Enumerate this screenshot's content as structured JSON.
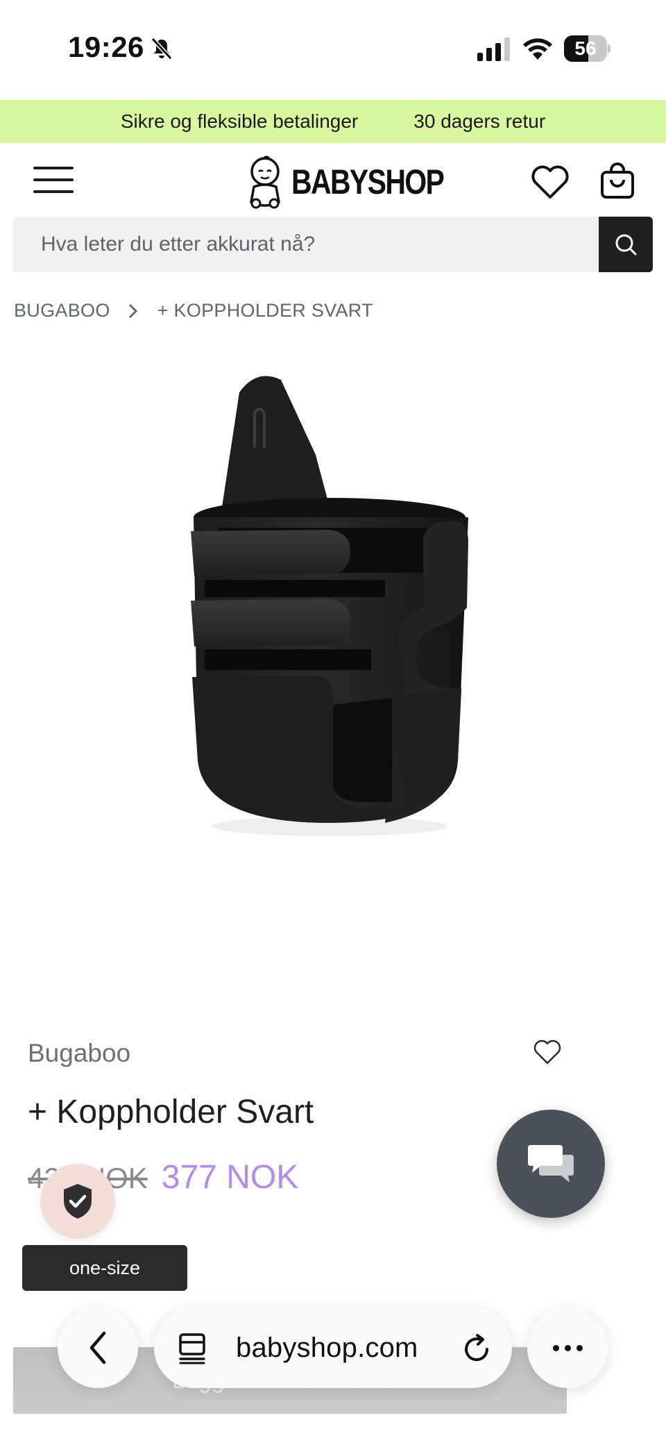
{
  "status_bar": {
    "time": "19:26",
    "battery_percent": "56",
    "battery_level": 0.56,
    "icons": [
      "bell-muted-icon",
      "cellular-signal-icon",
      "wifi-icon",
      "battery-icon"
    ]
  },
  "promo": {
    "items": [
      "Sikre og fleksible betalinger",
      "30 dagers retur"
    ]
  },
  "header": {
    "logo_text": "BABYSHOP",
    "icons": [
      "menu-icon",
      "heart-icon",
      "shopping-bag-icon"
    ]
  },
  "search": {
    "placeholder": "Hva leter du etter akkurat nå?",
    "icon": "search-icon"
  },
  "breadcrumb": {
    "items": [
      "BUGABOO",
      "+ KOPPHOLDER SVART"
    ]
  },
  "product": {
    "brand": "Bugaboo",
    "title": "+ Koppholder Svart",
    "old_price": "420 NOK",
    "price": "377 NOK",
    "size": "one-size",
    "add_to_cart_label": "Legg til i handlekurven",
    "image_alt": "cup-holder-product-image"
  },
  "browser": {
    "url": "babyshop.com",
    "icons": [
      "chevron-left-icon",
      "tabs-icon",
      "reload-icon",
      "more-icon"
    ]
  },
  "colors": {
    "promo_bg": "#d9f79f",
    "sale_price": "#b48be6",
    "chat_button": "#4a5159",
    "trust_badge": "#f3ddd9"
  }
}
